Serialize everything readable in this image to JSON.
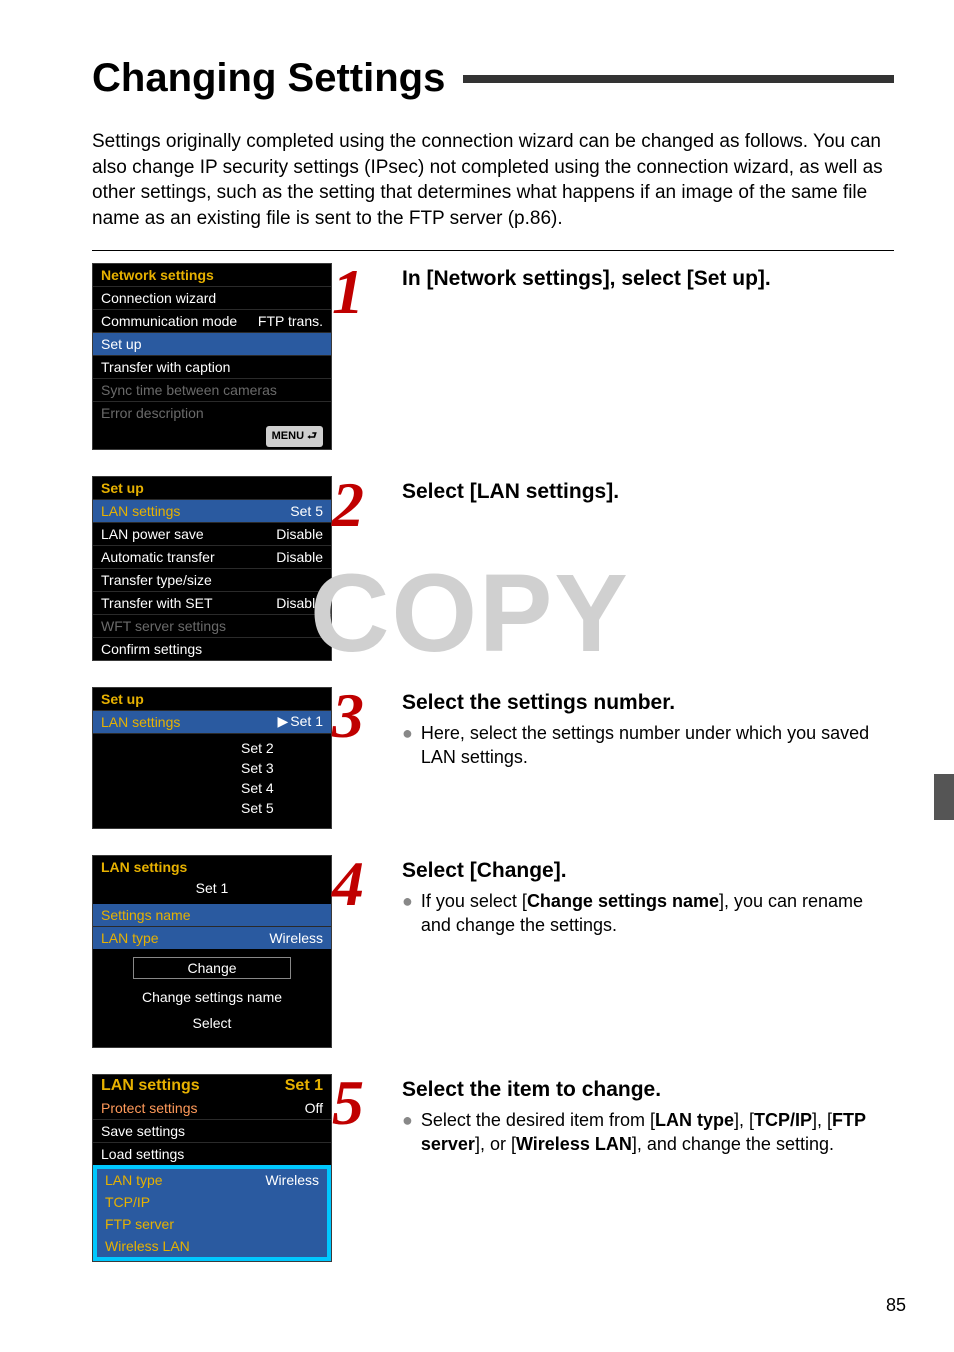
{
  "heading": "Changing Settings",
  "intro": "Settings originally completed using the connection wizard can be changed as follows. You can also change IP security settings (IPsec) not completed using the connection wizard, as well as other settings, such as the setting that determines what happens if an image of the same file name as an existing file is sent to the FTP server (p.86).",
  "watermark": "COPY",
  "menu_badge": "MENU ⮐",
  "steps": {
    "s1": {
      "num": "1",
      "title": "In [Network settings], select [Set up]."
    },
    "s2": {
      "num": "2",
      "title": "Select [LAN settings]."
    },
    "s3": {
      "num": "3",
      "title": "Select the settings number.",
      "body": "Here, select the settings number under which you saved LAN settings."
    },
    "s4": {
      "num": "4",
      "title": "Select [Change].",
      "body_a": "If you select [",
      "body_b": "Change settings name",
      "body_c": "], you can rename and change the settings."
    },
    "s5": {
      "num": "5",
      "title": "Select the item to change.",
      "body_a": "Select the desired item from [",
      "b1": "LAN type",
      "mid1": "], [",
      "b2": "TCP/IP",
      "mid2": "], [",
      "b3": "FTP server",
      "mid3": "], or [",
      "b4": "Wireless LAN",
      "tail": "], and change the setting."
    }
  },
  "lcd1": {
    "header": "Network settings",
    "rows": [
      {
        "label": "Connection wizard",
        "muted": false
      },
      {
        "label": "Communication mode",
        "value": "FTP trans."
      },
      {
        "label": "Set up",
        "hl": true
      },
      {
        "label": "Transfer with caption"
      },
      {
        "label": "Sync time between cameras",
        "muted": true
      },
      {
        "label": "Error description",
        "muted": true
      }
    ]
  },
  "lcd2": {
    "header": "Set up",
    "rows": [
      {
        "label": "LAN settings",
        "value": "Set 5",
        "label_orange": true,
        "hl": true
      },
      {
        "label": "LAN power save",
        "value": "Disable"
      },
      {
        "label": "Automatic transfer",
        "value": "Disable"
      },
      {
        "label": "Transfer type/size"
      },
      {
        "label": "Transfer with SET",
        "value": "Disable"
      },
      {
        "label": "WFT server settings",
        "muted": true
      },
      {
        "label": "Confirm settings"
      }
    ]
  },
  "lcd3": {
    "header": "Set up",
    "label": "LAN settings",
    "options": [
      "Set 1",
      "Set 2",
      "Set 3",
      "Set 4",
      "Set 5"
    ],
    "selected_index": 0,
    "current_cyan_index": 4
  },
  "lcd4": {
    "header": "LAN settings",
    "subtitle": "Set 1",
    "row1": {
      "label": "Settings name",
      "value": ""
    },
    "row2": {
      "label": "LAN type",
      "value": "Wireless"
    },
    "btn_change": "Change",
    "btn_rename": "Change settings name",
    "btn_select": "Select"
  },
  "lcd5": {
    "header": "LAN settings",
    "header_value": "Set 1",
    "rows_top": [
      {
        "label": "Protect settings",
        "value": "Off",
        "label_red": true
      },
      {
        "label": "Save settings"
      },
      {
        "label": "Load settings"
      }
    ],
    "rows_box": [
      {
        "label": "LAN type",
        "value": "Wireless"
      },
      {
        "label": "TCP/IP"
      },
      {
        "label": "FTP server"
      },
      {
        "label": "Wireless LAN"
      }
    ]
  },
  "page_number": "85"
}
